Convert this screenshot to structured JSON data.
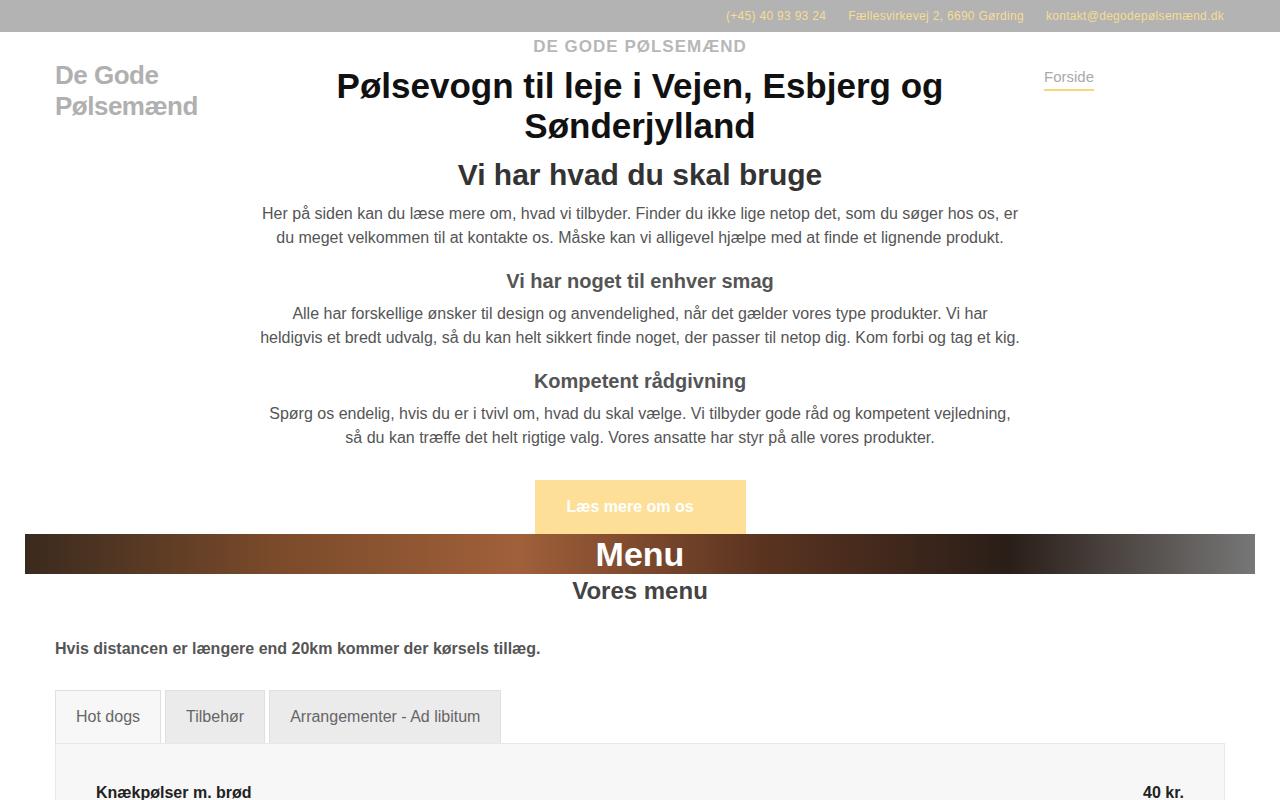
{
  "topbar": {
    "phone": "(+45) 40 93 93 24",
    "address": "Fællesvirkevej 2, 6690 Gørding",
    "email": "kontakt@degodepølsemænd.dk"
  },
  "logo": "De Gode Pølsemænd",
  "nav": [
    {
      "label": "Forside",
      "selected": true
    }
  ],
  "hero": {
    "eyebrow": "DE GODE PØLSEMÆND",
    "title": "Pølsevogn til leje i Vejen, Esbjerg og Sønderjylland",
    "subtitle": "Vi har hvad du skal bruge",
    "intro": "Her på siden kan du læse mere om, hvad vi tilbyder. Finder du ikke lige netop det, som du søger hos os, er du meget velkommen til at kontakte os. Måske kan vi alligevel hjælpe med at finde et lignende produkt.",
    "sections": [
      {
        "heading": "Vi har noget til enhver smag",
        "text": "Alle har forskellige ønsker til design og anvendelighed, når det gælder vores type produkter. Vi har heldigvis et bredt udvalg, så du kan helt sikkert finde noget, der passer til netop dig. Kom forbi og tag et kig."
      },
      {
        "heading": "Kompetent rådgivning",
        "text": "Spørg os endelig, hvis du er i tvivl om, hvad du skal vælge. Vi tilbyder gode råd og kompetent vejledning, så du kan træffe det helt rigtige valg. Vores ansatte har styr på alle vores produkter."
      }
    ],
    "button": "Læs mere om os"
  },
  "menu": {
    "banner_title": "Menu",
    "subtitle": "Vores menu",
    "note": "Hvis distancen er længere end 20km kommer der kørsels tillæg.",
    "tabs": [
      {
        "label": "Hot dogs",
        "selected": true
      },
      {
        "label": "Tilbehør",
        "selected": false
      },
      {
        "label": "Arrangementer - Ad libitum",
        "selected": false
      }
    ],
    "items": [
      {
        "name": "Knækpølser m. brød",
        "price": "40 kr."
      }
    ]
  }
}
